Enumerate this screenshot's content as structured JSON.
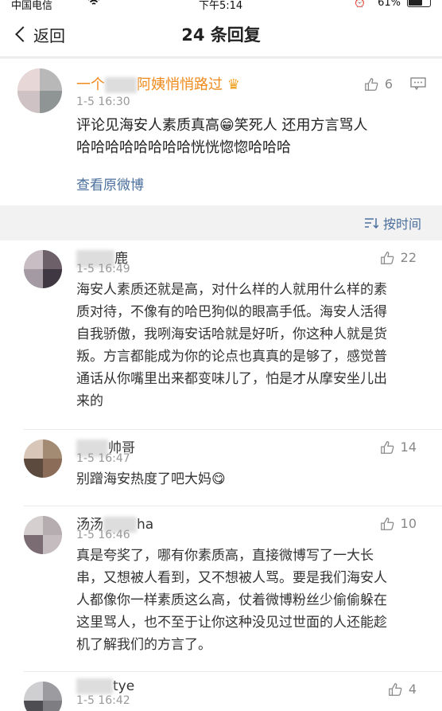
{
  "status": {
    "carrier": "中国电信",
    "time": "下午5:14",
    "battery": "61%"
  },
  "nav": {
    "back_label": "返回",
    "title": "24 条回复"
  },
  "main": {
    "username_pre": "一个",
    "username_post": "阿姨悄悄路过",
    "timestamp": "1-5 16:30",
    "likes": "6",
    "content_line1": "评论见海安人素质真高😁笑死人 还用方言骂人",
    "content_line2": "哈哈哈哈哈哈哈哈恍恍惚惚哈哈哈",
    "view_original": "查看原微博"
  },
  "sort": {
    "label": "按时间"
  },
  "replies": [
    {
      "username_suffix": "鹿",
      "timestamp": "1-5 16:49",
      "likes": "22",
      "lines": [
        "海安人素质还就是高，对什么样的人就用什么样的素",
        "质对待，不像有的哈巴狗似的眼高手低。海安人活得",
        "自我骄傲，我咧海安话哈就是好听，你这种人就是货",
        "叛。方言都能成为你的论点也真真的是够了，感觉普",
        "通话从你嘴里出来都变味儿了，怕是才从摩安坐儿出",
        "来的"
      ]
    },
    {
      "username_suffix": "帅哥",
      "timestamp": "1-5 16:47",
      "likes": "14",
      "lines": [
        "别蹭海安热度了吧大妈😋"
      ]
    },
    {
      "username_prefix": "汤汤",
      "username_suffix": "ha",
      "timestamp": "1-5 16:46",
      "likes": "10",
      "lines": [
        "真是夸奖了，哪有你素质高，直接微博写了一大长",
        "串，又想被人看到，又不想被人骂。要是我们海安人",
        "人都像你一样素质这么高，仗着微博粉丝少偷偷躲在",
        "这里骂人，也不至于让你这种没见过世面的人还能趁",
        "机了解我们的方言了。"
      ]
    },
    {
      "username_suffix": "tye",
      "timestamp": "1-5 16:42",
      "likes": "4",
      "lines": []
    }
  ]
}
